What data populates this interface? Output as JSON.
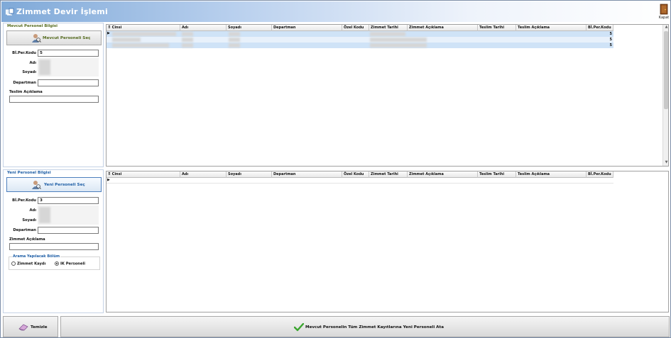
{
  "window": {
    "title": "Zimmet Devir İşlemi",
    "close_label": "Kapat"
  },
  "current_personnel": {
    "section_title": "Mevcut Personel Bilgisi",
    "select_button": "Mevcut Personeli Seç",
    "labels": {
      "code": "Bİ.Per.Kodu",
      "name": "Adı",
      "surname": "Soyadı",
      "department": "Departman",
      "note": "Teslim Açıklama"
    },
    "values": {
      "code": "5",
      "department": "",
      "note": ""
    }
  },
  "new_personnel": {
    "section_title": "Yeni Personel Bilgisi",
    "select_button": "Yeni Personeli Seç",
    "labels": {
      "code": "Bİ.Per.Kodu",
      "name": "Adı",
      "surname": "Soyadı",
      "department": "Departman",
      "note": "Zimmet Açıklama"
    },
    "values": {
      "code": "3",
      "department": "",
      "note": ""
    },
    "search_group": {
      "title": "Arama Yapılacak Bölüm",
      "options": [
        "Zimmet Kaydı",
        "IK Personeli"
      ],
      "selected": "IK Personeli"
    }
  },
  "grid_columns": [
    "Cinsi",
    "Adı",
    "Soyadı",
    "Departman",
    "Özel Kodu",
    "Zimmet Tarihi",
    "Zimmet Açıklama",
    "Teslim Tarihi",
    "Teslim Açıklama",
    "Bİ.Per.Kodu"
  ],
  "grid1": {
    "rows": [
      {
        "code": "5"
      },
      {
        "code": "5"
      },
      {
        "code": "5"
      }
    ]
  },
  "grid2": {
    "rows": []
  },
  "buttons": {
    "clear": "Temizle",
    "assign": "Mevcut Personelin Tüm Zimmet Kayıtlarına Yeni Personeli Ata"
  },
  "colors": {
    "title_gradient_start": "#7fa9d8",
    "selected_row": "#cfe3f7",
    "section_current": "#556b1f",
    "section_new": "#1f5fa6",
    "accept_check": "#3aa52e"
  }
}
